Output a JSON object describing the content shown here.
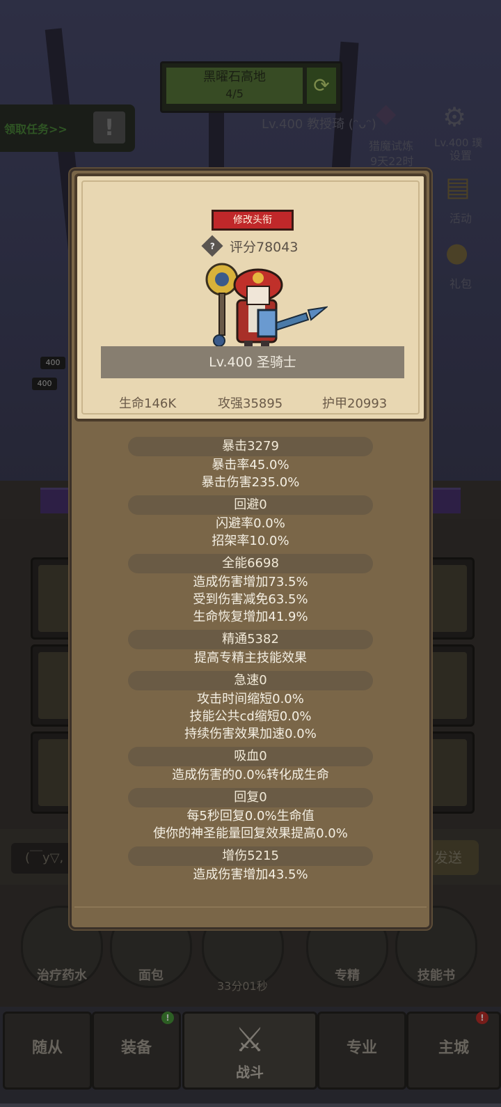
{
  "background": {
    "zone_name": "黑曜石高地",
    "zone_progress": "4/5",
    "quest_tab": "领取任务>>",
    "boss_text": "Lv.400 教授琦 (ᵔᴗᵔ)",
    "event_name": "猎魔试炼",
    "event_time": "9天22时",
    "side_lv": "Lv.400 璞",
    "settings_label": "设置",
    "activity_label": "活动",
    "gift_label": "礼包",
    "level_tag_1": "400",
    "level_tag_2": "400",
    "chat_placeholder": "(￣y▽,",
    "send_label": "发送"
  },
  "card": {
    "edit_title_button": "修改头衔",
    "score": "评分78043",
    "hero_level_class": "Lv.400 圣骑士",
    "hp": "生命146K",
    "attack": "攻强35895",
    "armor": "护甲20993",
    "stats": [
      {
        "head": "暴击3279",
        "lines": [
          "暴击率45.0%",
          "暴击伤害235.0%"
        ]
      },
      {
        "head": "回避0",
        "lines": [
          "闪避率0.0%",
          "招架率10.0%"
        ]
      },
      {
        "head": "全能6698",
        "lines": [
          "造成伤害增加73.5%",
          "受到伤害减免63.5%",
          "生命恢复增加41.9%"
        ]
      },
      {
        "head": "精通5382",
        "lines": [
          "提高专精主技能效果"
        ]
      },
      {
        "head": "急速0",
        "lines": [
          "攻击时间缩短0.0%",
          "技能公共cd缩短0.0%",
          "持续伤害效果加速0.0%"
        ]
      },
      {
        "head": "吸血0",
        "lines": [
          "造成伤害的0.0%转化成生命"
        ]
      },
      {
        "head": "回复0",
        "lines": [
          "每5秒回复0.0%生命值",
          "使你的神圣能量回复效果提高0.0%"
        ]
      },
      {
        "head": "增伤5215",
        "lines": [
          "造成伤害增加43.5%"
        ]
      }
    ]
  },
  "hud": {
    "potion": "治疗药水",
    "bread": "面包",
    "timer": "33分01秒",
    "spec": "专精",
    "skillbook": "技能书"
  },
  "tabs": {
    "followers": "随从",
    "equipment": "装备",
    "battle": "战斗",
    "profession": "专业",
    "city": "主城"
  },
  "colors": {
    "card_frame": "#e8d7b2",
    "card_body": "#7a6648",
    "edit_button": "#c0282a",
    "stat_pill": "#6a5b45"
  }
}
